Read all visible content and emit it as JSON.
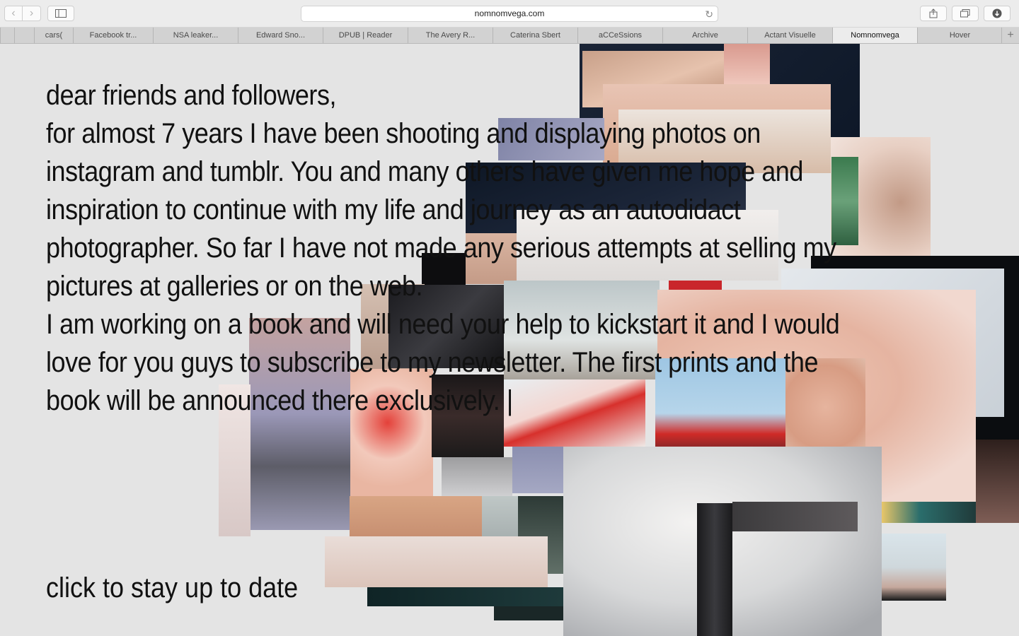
{
  "browser": {
    "url": "nomnomvega.com",
    "tabs": [
      {
        "label": "",
        "active": false
      },
      {
        "label": "",
        "active": false
      },
      {
        "label": "cars(",
        "active": false
      },
      {
        "label": "Facebook tr...",
        "active": false
      },
      {
        "label": "NSA leaker...",
        "active": false
      },
      {
        "label": "Edward Sno...",
        "active": false
      },
      {
        "label": "DPUB | Reader",
        "active": false
      },
      {
        "label": "The Avery R...",
        "active": false
      },
      {
        "label": "Caterina Sbert",
        "active": false
      },
      {
        "label": "aCCeSsions",
        "active": false
      },
      {
        "label": "Archive",
        "active": false
      },
      {
        "label": "Actant Visuelle",
        "active": false
      },
      {
        "label": "Nomnomvega",
        "active": true
      },
      {
        "label": "Hover",
        "active": false
      }
    ],
    "icons": {
      "back": "chevron-left-icon",
      "forward": "chevron-right-icon",
      "sidebar": "sidebar-icon",
      "reload": "reload-icon",
      "share": "share-icon",
      "tabs": "tab-overview-icon",
      "downloads": "download-icon",
      "new_tab": "plus-icon"
    }
  },
  "letter": {
    "lines": [
      "dear friends and followers,",
      "for almost 7 years I have been shooting and displaying photos on",
      "instagram and tumblr. You and many others have given me hope and",
      "inspiration to continue with my life and journey as an autodidact",
      "photographer. So far I have not made any serious attempts at selling my",
      "pictures at galleries or on the web.",
      "I am working on a book and will need your help to kickstart it and I would",
      "love for you guys to subscribe to my newsletter. The first prints and the",
      "book will be announced there exclusively. |"
    ]
  },
  "cta": {
    "label": "click to stay up to date"
  },
  "photo_collage": {
    "description_colors": {
      "dark": "#0d1a2a",
      "skin": "#e3b8a1",
      "red": "#d3231f",
      "pale": "#ebdcd4"
    }
  }
}
